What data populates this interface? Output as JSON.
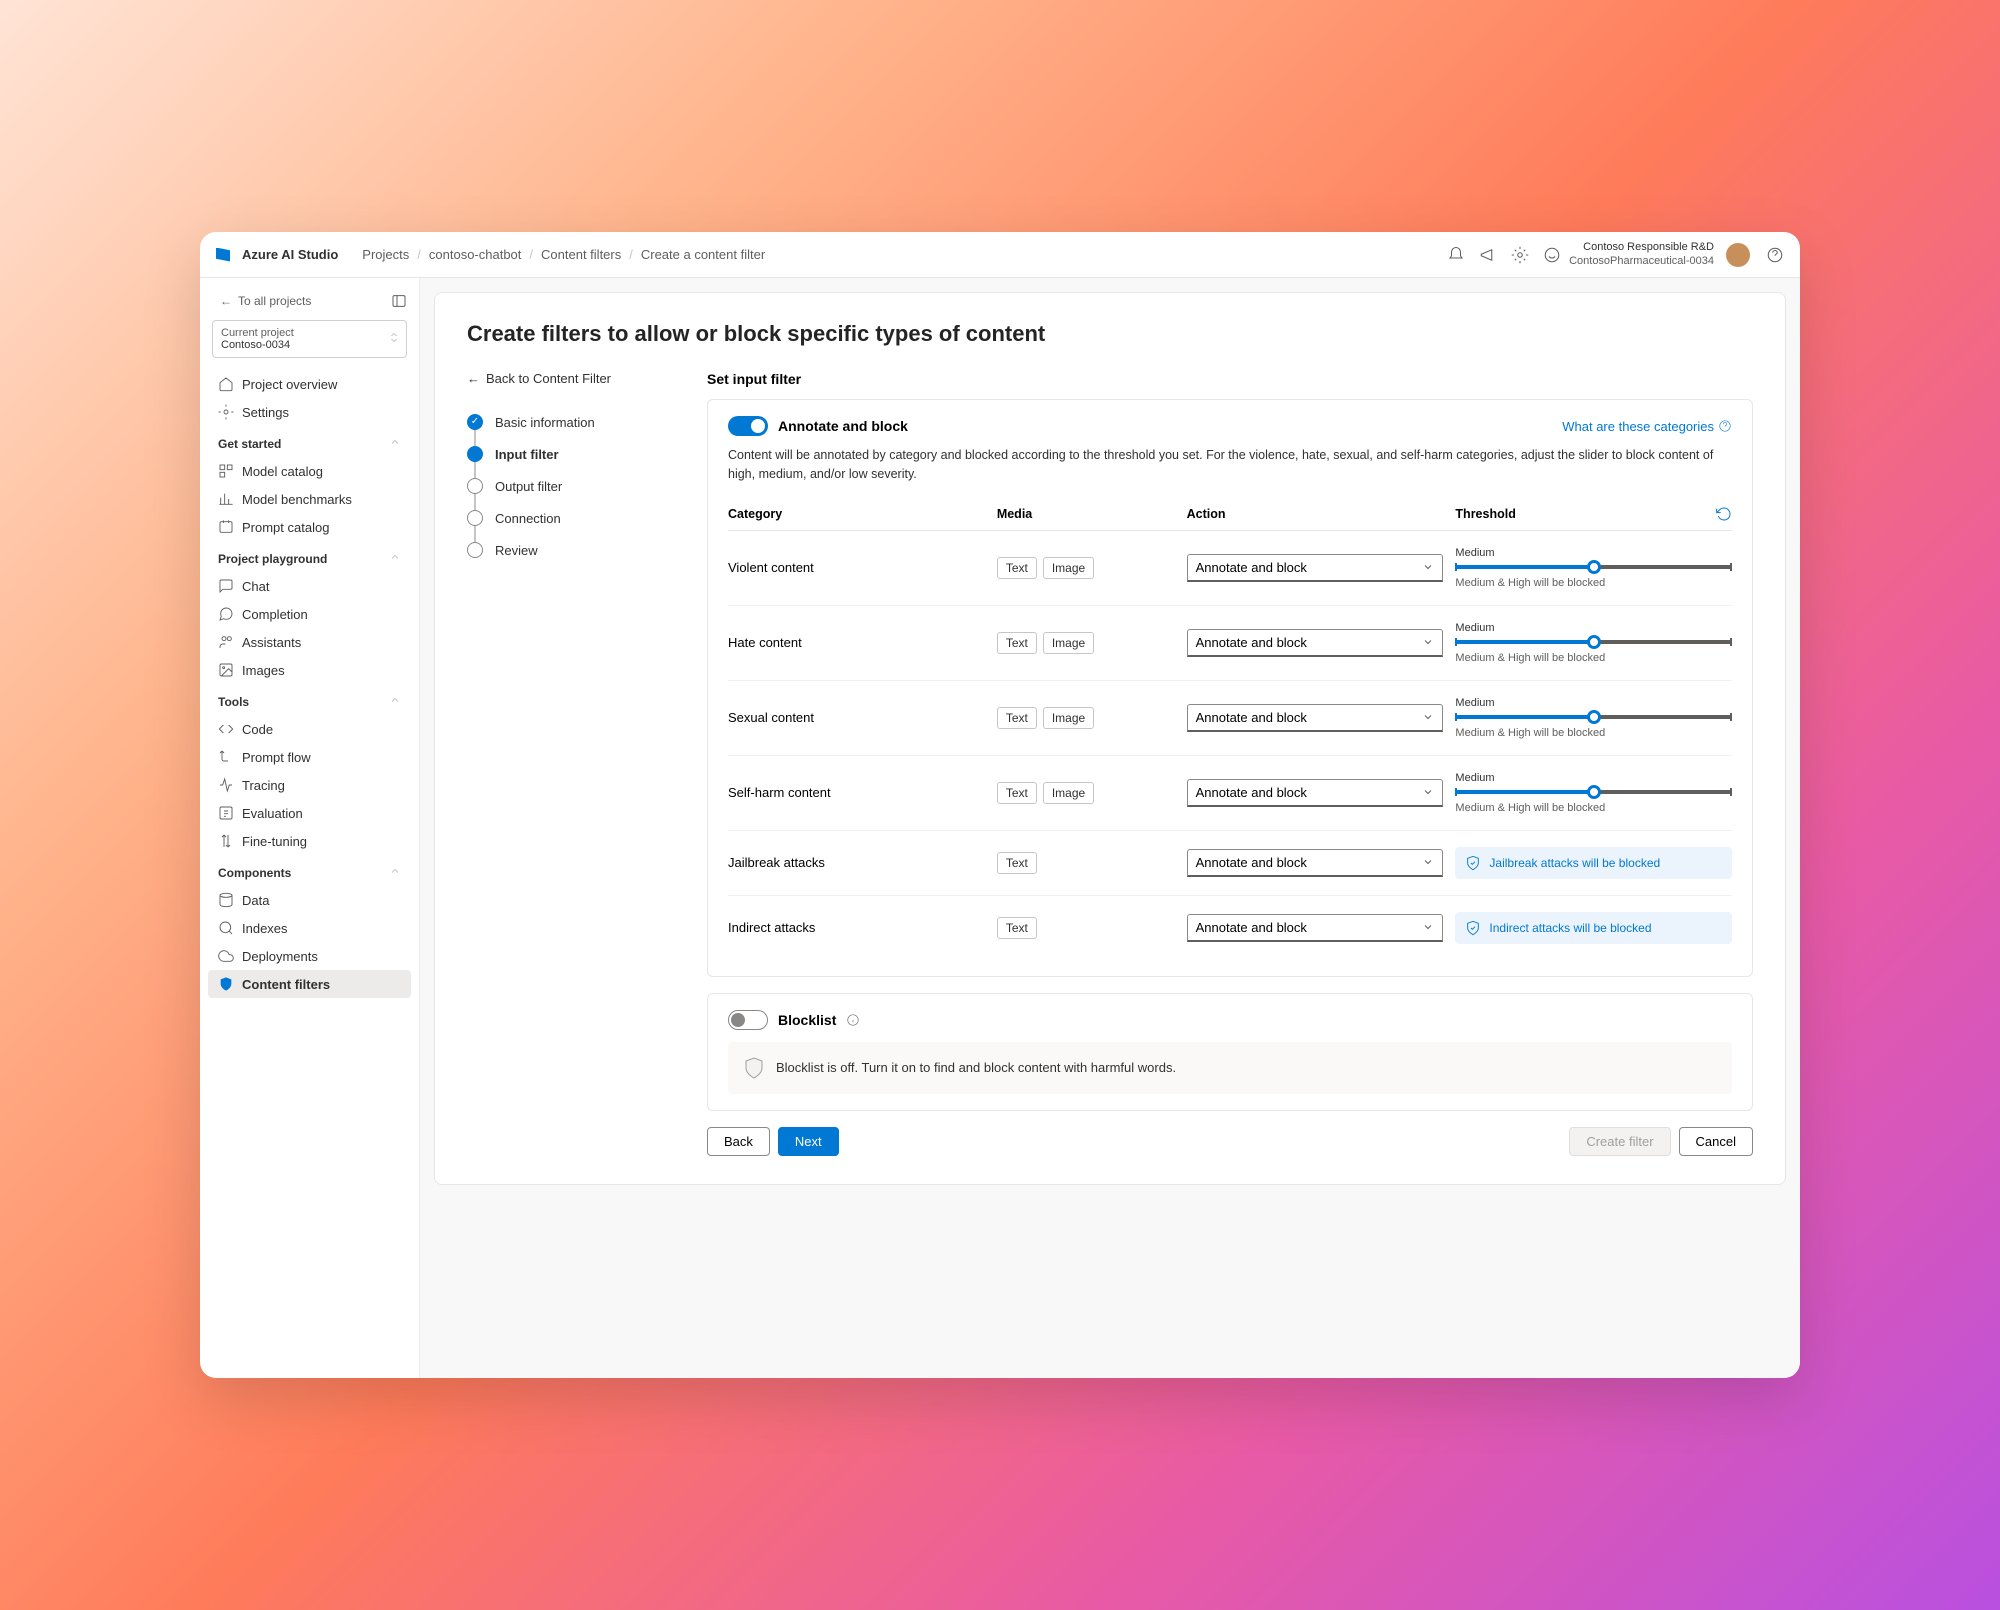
{
  "brand": "Azure AI Studio",
  "breadcrumbs": [
    "Projects",
    "contoso-chatbot",
    "Content filters",
    "Create a content filter"
  ],
  "user": {
    "name": "Contoso Responsible R&D",
    "sub": "ContosoPharmaceutical-0034"
  },
  "sidebar": {
    "back": "To all projects",
    "project": {
      "label": "Current project",
      "value": "Contoso-0034"
    },
    "overview": "Project overview",
    "settings": "Settings",
    "groups": {
      "getStarted": "Get started",
      "playground": "Project playground",
      "tools": "Tools",
      "components": "Components"
    },
    "items": {
      "modelCatalog": "Model catalog",
      "modelBenchmarks": "Model benchmarks",
      "promptCatalog": "Prompt catalog",
      "chat": "Chat",
      "completion": "Completion",
      "assistants": "Assistants",
      "images": "Images",
      "code": "Code",
      "promptFlow": "Prompt flow",
      "tracing": "Tracing",
      "evaluation": "Evaluation",
      "fineTuning": "Fine-tuning",
      "data": "Data",
      "indexes": "Indexes",
      "deployments": "Deployments",
      "contentFilters": "Content filters"
    }
  },
  "page": {
    "title": "Create filters to allow or block specific types of content",
    "backLink": "Back to Content Filter",
    "steps": [
      "Basic information",
      "Input filter",
      "Output filter",
      "Connection",
      "Review"
    ],
    "sectionTitle": "Set input filter",
    "togglePanel": {
      "title": "Annotate and block",
      "helpLink": "What are these categories",
      "desc": "Content will be annotated by category and blocked according to the threshold you set. For the violence, hate, sexual, and self-harm categories, adjust the slider to block content of high, medium, and/or low severity."
    },
    "columns": {
      "category": "Category",
      "media": "Media",
      "action": "Action",
      "threshold": "Threshold"
    },
    "mediaTags": {
      "text": "Text",
      "image": "Image"
    },
    "actionValue": "Annotate and block",
    "thresh": {
      "label": "Medium",
      "hint": "Medium & High will be blocked"
    },
    "rows": [
      {
        "cat": "Violent content",
        "media": [
          "text",
          "image"
        ],
        "type": "slider"
      },
      {
        "cat": "Hate content",
        "media": [
          "text",
          "image"
        ],
        "type": "slider"
      },
      {
        "cat": "Sexual content",
        "media": [
          "text",
          "image"
        ],
        "type": "slider"
      },
      {
        "cat": "Self-harm content",
        "media": [
          "text",
          "image"
        ],
        "type": "slider"
      },
      {
        "cat": "Jailbreak attacks",
        "media": [
          "text"
        ],
        "type": "info",
        "info": "Jailbreak attacks will be blocked"
      },
      {
        "cat": "Indirect attacks",
        "media": [
          "text"
        ],
        "type": "info",
        "info": "Indirect attacks will be blocked"
      }
    ],
    "blocklist": {
      "title": "Blocklist",
      "offText": "Blocklist is off. Turn it on to find and block content with harmful words."
    },
    "buttons": {
      "back": "Back",
      "next": "Next",
      "create": "Create filter",
      "cancel": "Cancel"
    }
  }
}
